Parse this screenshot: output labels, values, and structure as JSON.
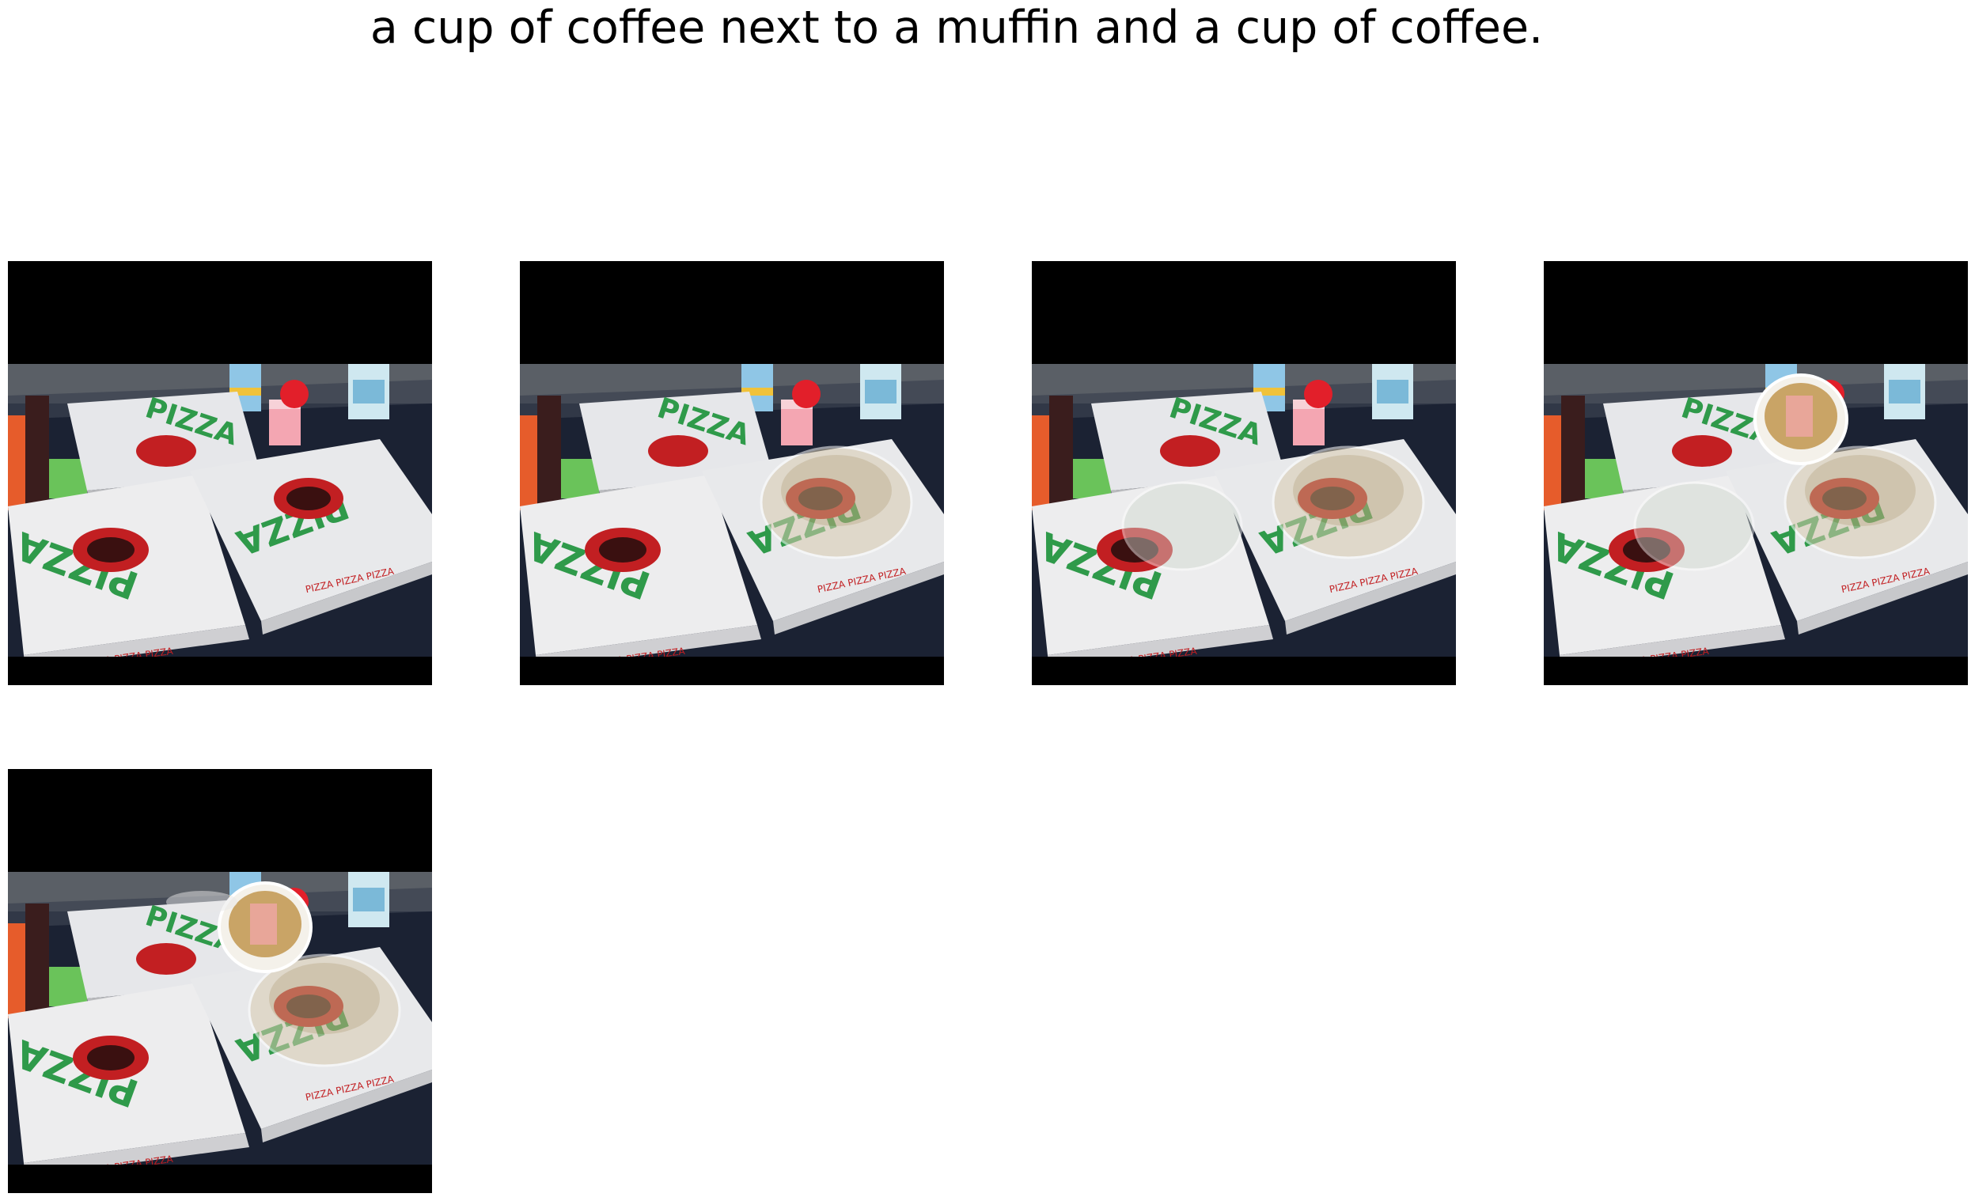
{
  "figure": {
    "caption": "a cup of coffee next to a muffin and a cup of coffee."
  },
  "panels": [
    {
      "id": "p1",
      "overlay_cups": []
    },
    {
      "id": "p2",
      "overlay_cups": [
        "ghost-right"
      ]
    },
    {
      "id": "p3",
      "overlay_cups": [
        "ghost-right",
        "ghost-center"
      ]
    },
    {
      "id": "p4",
      "overlay_cups": [
        "ghost-right",
        "ghost-center",
        "coffee-top"
      ]
    },
    {
      "id": "p5",
      "overlay_cups": [
        "ghost-right",
        "coffee-top",
        "ghost-left"
      ]
    }
  ],
  "box_text": {
    "logo": "PIZZA",
    "side": "PIZZA PIZZA PIZZA"
  }
}
